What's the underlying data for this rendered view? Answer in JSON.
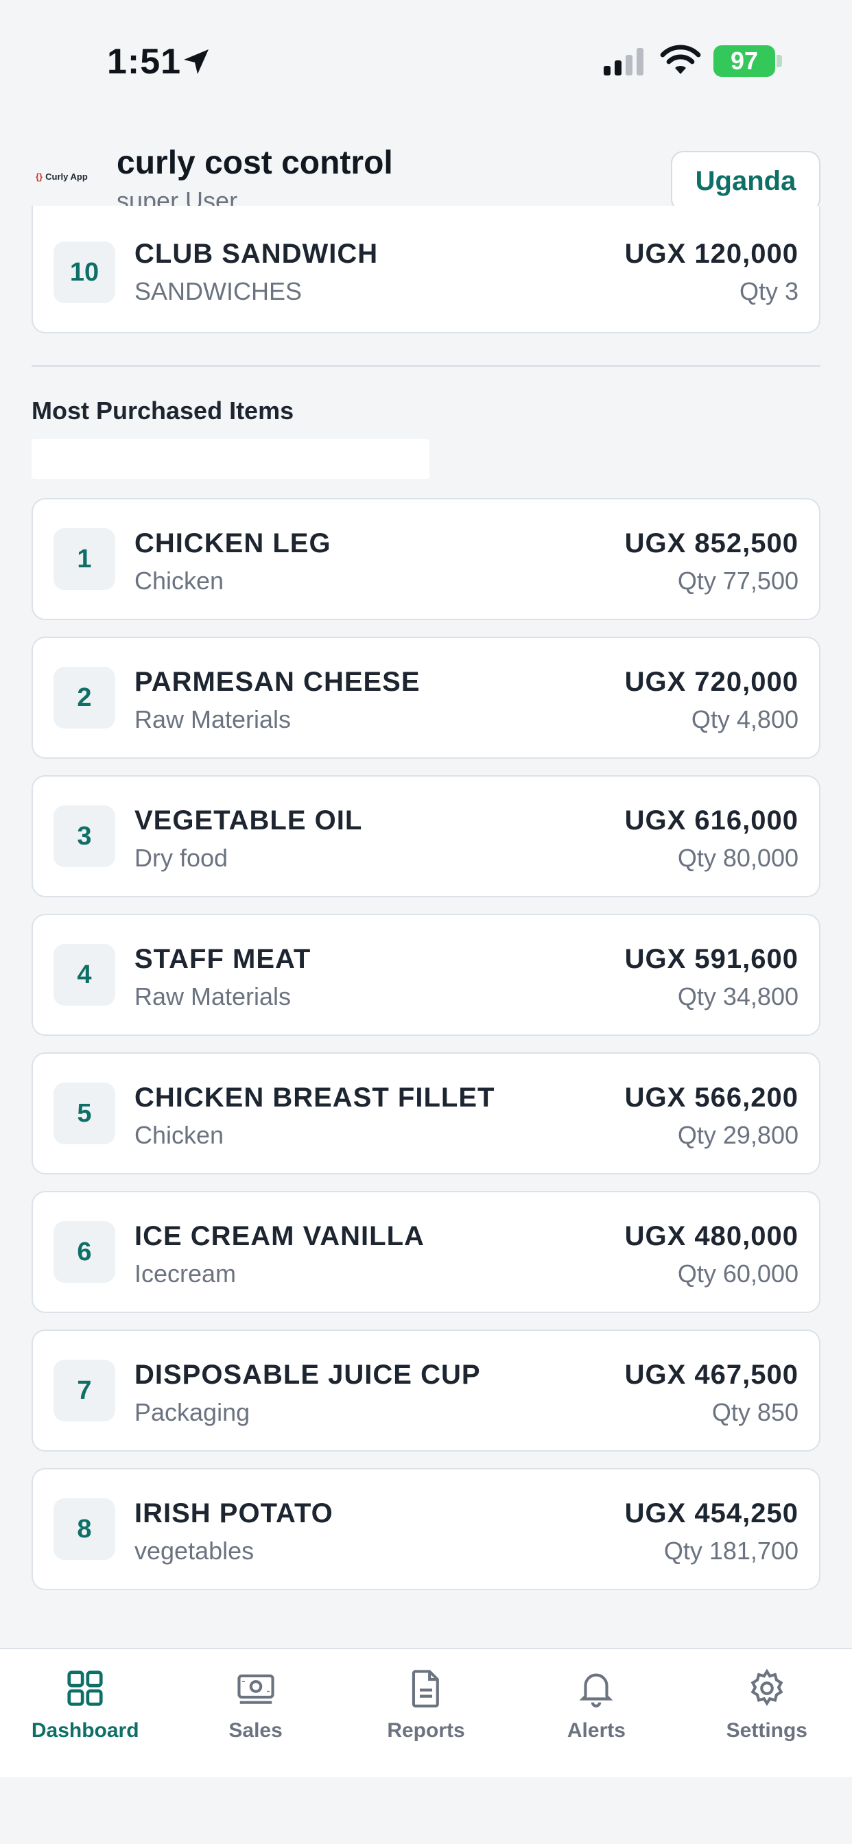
{
  "status_bar": {
    "time": "1:51",
    "battery": "97"
  },
  "header": {
    "logo_text": "Curly App",
    "logo_braces": "{}",
    "title": "curly cost control",
    "subtitle": "super User",
    "country_button": "Uganda"
  },
  "top_item": {
    "rank": "10",
    "name": "CLUB SANDWICH",
    "category": "SANDWICHES",
    "amount": "UGX 120,000",
    "qty": "Qty 3"
  },
  "section": {
    "title": "Most Purchased Items"
  },
  "items": [
    {
      "rank": "1",
      "name": "CHICKEN LEG",
      "category": "Chicken",
      "amount": "UGX 852,500",
      "qty": "Qty 77,500"
    },
    {
      "rank": "2",
      "name": "PARMESAN CHEESE",
      "category": "Raw Materials",
      "amount": "UGX 720,000",
      "qty": "Qty 4,800"
    },
    {
      "rank": "3",
      "name": "VEGETABLE OIL",
      "category": "Dry food",
      "amount": "UGX 616,000",
      "qty": "Qty 80,000"
    },
    {
      "rank": "4",
      "name": "STAFF MEAT",
      "category": "Raw Materials",
      "amount": "UGX 591,600",
      "qty": "Qty 34,800"
    },
    {
      "rank": "5",
      "name": "CHICKEN BREAST FILLET",
      "category": "Chicken",
      "amount": "UGX 566,200",
      "qty": "Qty 29,800"
    },
    {
      "rank": "6",
      "name": "ICE CREAM VANILLA",
      "category": "Icecream",
      "amount": "UGX 480,000",
      "qty": "Qty 60,000"
    },
    {
      "rank": "7",
      "name": "DISPOSABLE JUICE CUP",
      "category": "Packaging",
      "amount": "UGX 467,500",
      "qty": "Qty 850"
    },
    {
      "rank": "8",
      "name": "IRISH POTATO",
      "category": "vegetables",
      "amount": "UGX 454,250",
      "qty": "Qty 181,700"
    }
  ],
  "tabs": [
    {
      "label": "Dashboard",
      "icon": "grid-icon",
      "active": true
    },
    {
      "label": "Sales",
      "icon": "cash-icon",
      "active": false
    },
    {
      "label": "Reports",
      "icon": "document-icon",
      "active": false
    },
    {
      "label": "Alerts",
      "icon": "bell-icon",
      "active": false
    },
    {
      "label": "Settings",
      "icon": "gear-icon",
      "active": false
    }
  ],
  "colors": {
    "accent": "#0e6f66",
    "battery": "#34c759",
    "muted": "#6b7380"
  }
}
